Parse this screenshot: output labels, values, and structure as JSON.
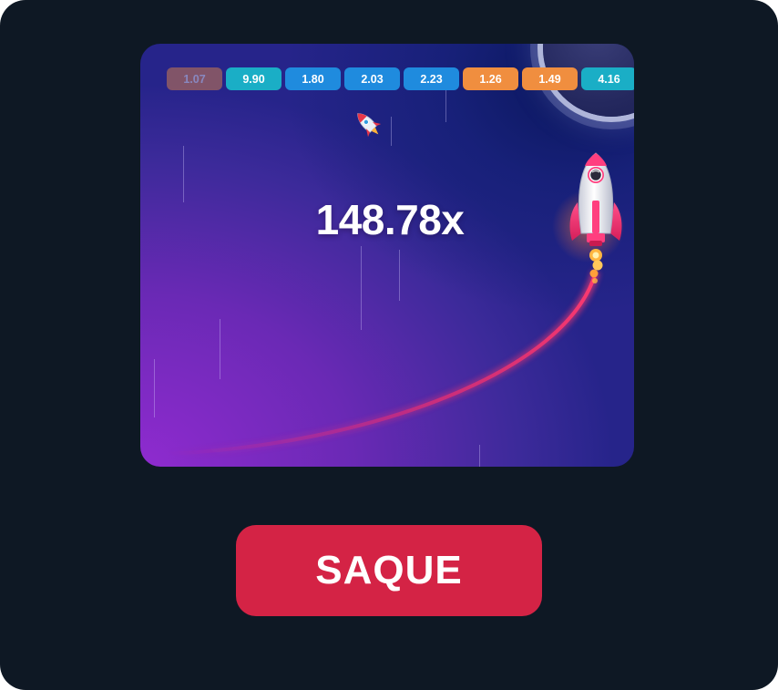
{
  "history": [
    {
      "value": "1.07",
      "color": "orange",
      "faded": true
    },
    {
      "value": "9.90",
      "color": "cyan",
      "faded": false
    },
    {
      "value": "1.80",
      "color": "blue",
      "faded": false
    },
    {
      "value": "2.03",
      "color": "blue",
      "faded": false
    },
    {
      "value": "2.23",
      "color": "blue",
      "faded": false
    },
    {
      "value": "1.26",
      "color": "orange",
      "faded": false
    },
    {
      "value": "1.49",
      "color": "orange",
      "faded": false
    },
    {
      "value": "4.16",
      "color": "cyan",
      "faded": false
    }
  ],
  "multiplier": "148.78x",
  "cashout_label": "SAQUE",
  "colors": {
    "background": "#0e1824",
    "cashout_button": "#d42345",
    "chip_blue": "#1f8bde",
    "chip_cyan": "#1aaec6",
    "chip_orange": "#f08e3f",
    "trail": "#ff2f6a"
  },
  "icons": [
    "rocket-icon-small",
    "rocket-icon-large",
    "planet-decoration"
  ]
}
